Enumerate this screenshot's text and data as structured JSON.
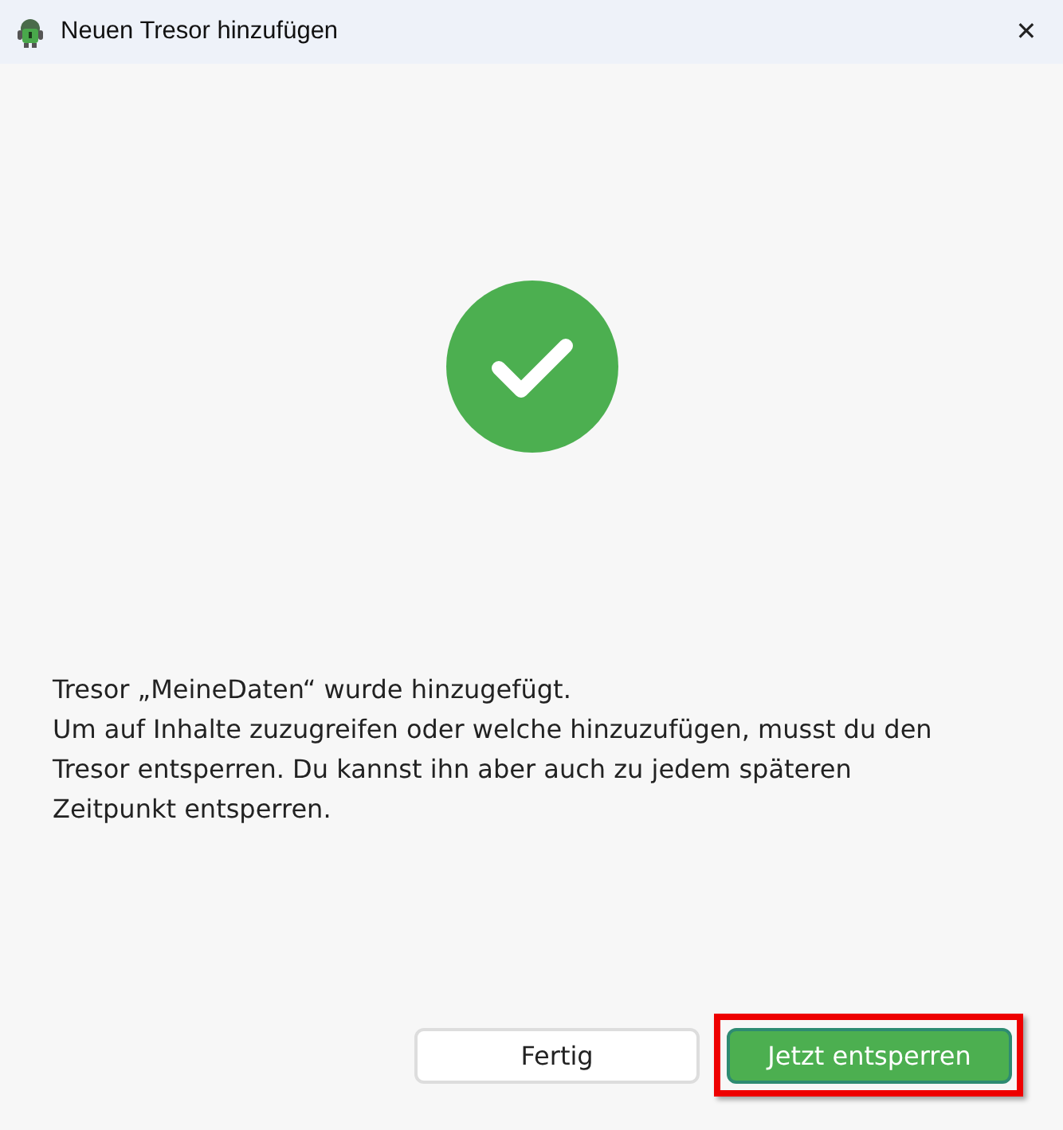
{
  "window": {
    "title": "Neuen Tresor hinzufügen",
    "close": "✕"
  },
  "status": {
    "kind": "success"
  },
  "message": {
    "title": "Tresor „MeineDaten“ wurde hinzugefügt.",
    "body": "Um auf Inhalte zuzugreifen oder welche hinzuzufügen, musst du den Tresor entsperren. Du kannst ihn aber auch zu jedem späteren Zeitpunkt entsperren."
  },
  "buttons": [
    {
      "label": "Fertig",
      "kind": "secondary",
      "highlighted": false
    },
    {
      "label": "Jetzt entsperren",
      "kind": "primary",
      "highlighted": true
    }
  ]
}
